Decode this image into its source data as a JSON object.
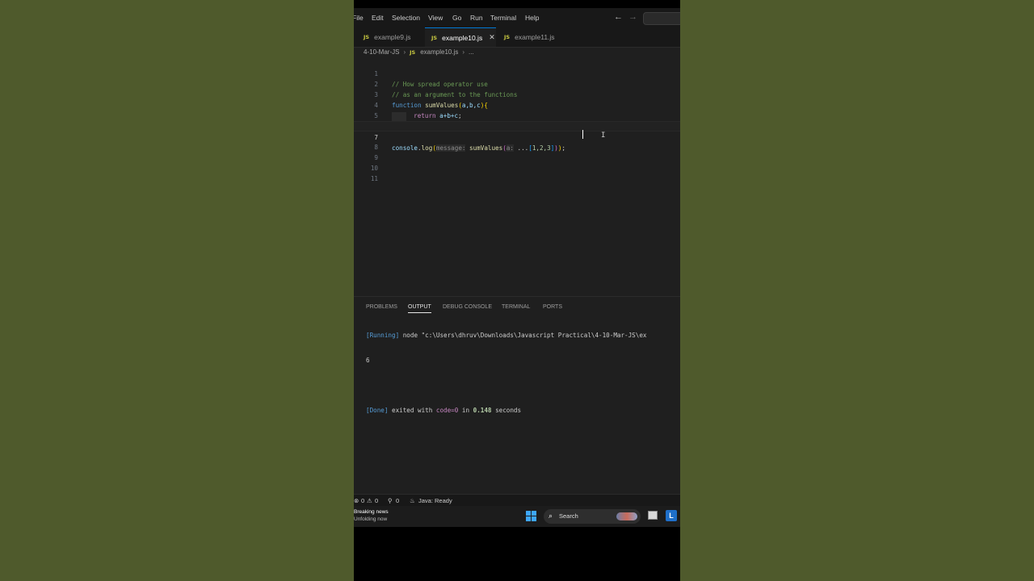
{
  "menu": [
    "File",
    "Edit",
    "Selection",
    "View",
    "Go",
    "Run",
    "Terminal",
    "Help"
  ],
  "tabs": [
    {
      "label": "example9.js",
      "badge": "JS"
    },
    {
      "label": "example10.js",
      "badge": "JS",
      "active": true
    },
    {
      "label": "example11.js",
      "badge": "JS"
    }
  ],
  "breadcrumb": {
    "folder": "4-10-Mar-JS",
    "badge": "JS",
    "file": "example10.js",
    "more": "..."
  },
  "editor": {
    "line_numbers": [
      "1",
      "2",
      "3",
      "4",
      "5",
      "6",
      "7",
      "8",
      "9",
      "10",
      "11"
    ],
    "current_line": 7,
    "code": {
      "l1": "// How spread operator use",
      "l2": "// as an argument to the functions",
      "l3_kw": "function",
      "l3_fn": "sumValues",
      "l3_params": "a,b,c",
      "l4_kw": "return",
      "l4_expr": "a+b+c",
      "l7_obj": "console",
      "l7_method": "log",
      "l7_hint1": "message:",
      "l7_fn": "sumValues",
      "l7_hint2": "a:",
      "l7_spread": "...",
      "l7_nums": "1,2,3"
    }
  },
  "panel": {
    "tabs": [
      "PROBLEMS",
      "OUTPUT",
      "DEBUG CONSOLE",
      "TERMINAL",
      "PORTS"
    ],
    "active_tab": "OUTPUT",
    "output": {
      "running_tag": "[Running]",
      "running_cmd": "node \"c:\\Users\\dhruv\\Downloads\\Javascript Practical\\4-10-Mar-JS\\ex",
      "result": "6",
      "done_tag": "[Done]",
      "done_text1": "exited with",
      "done_code": "code=0",
      "done_text2": "in",
      "done_time": "0.148",
      "done_text3": "seconds"
    }
  },
  "status": {
    "errors": "0",
    "warnings": "0",
    "ports": "0",
    "java": "Java: Ready"
  },
  "taskbar": {
    "news_title": "Breaking news",
    "news_sub": "Unfolding now",
    "search_label": "Search",
    "app_letter": "L"
  },
  "colors": {
    "accent": "#0078d4",
    "background": "#1f1f1f",
    "outer_background": "#4f5a2c"
  }
}
